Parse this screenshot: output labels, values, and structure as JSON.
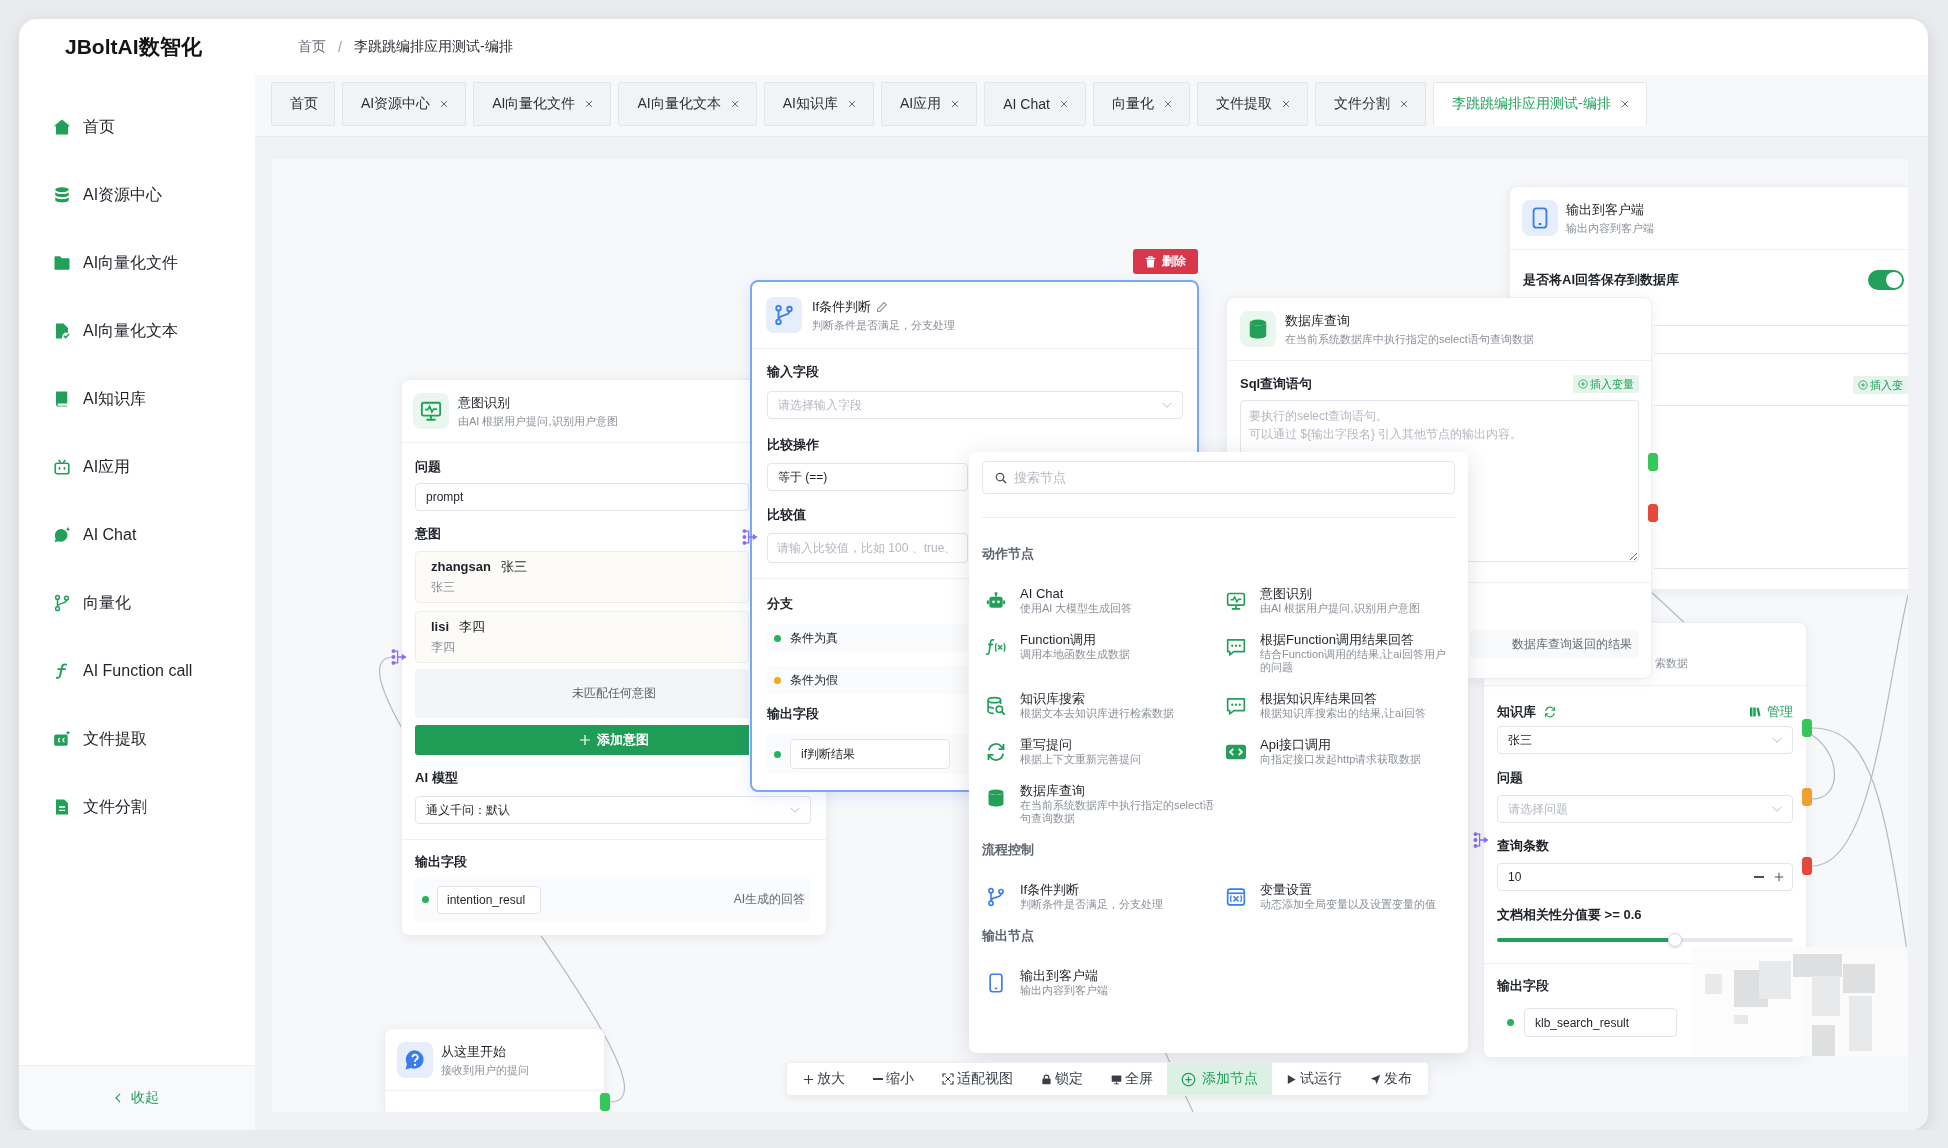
{
  "header": {
    "logo": "JBoltAI数智化",
    "breadcrumb": {
      "items": [
        "首页",
        "李跳跳编排应用测试-编排"
      ],
      "separator": "/"
    }
  },
  "sidebar": {
    "items": [
      {
        "label": "首页",
        "selected": false
      },
      {
        "label": "AI资源中心",
        "selected": false
      },
      {
        "label": "AI向量化文件",
        "selected": false
      },
      {
        "label": "AI向量化文本",
        "selected": false
      },
      {
        "label": "AI知识库",
        "selected": false
      },
      {
        "label": "AI应用",
        "selected": false
      },
      {
        "label": "AI Chat",
        "selected": false
      },
      {
        "label": "向量化",
        "selected": false
      },
      {
        "label": "AI Function call",
        "selected": false
      },
      {
        "label": "文件提取",
        "selected": false
      },
      {
        "label": "文件分割",
        "selected": false
      }
    ],
    "collapse": "收起"
  },
  "tabs": [
    {
      "label": "首页",
      "closable": false,
      "selected": false
    },
    {
      "label": "AI资源中心",
      "closable": true,
      "selected": false
    },
    {
      "label": "AI向量化文件",
      "closable": true,
      "selected": false
    },
    {
      "label": "AI向量化文本",
      "closable": true,
      "selected": false
    },
    {
      "label": "AI知识库",
      "closable": true,
      "selected": false
    },
    {
      "label": "AI应用",
      "closable": true,
      "selected": false
    },
    {
      "label": "AI Chat",
      "closable": true,
      "selected": false
    },
    {
      "label": "向量化",
      "closable": true,
      "selected": false
    },
    {
      "label": "文件提取",
      "closable": true,
      "selected": false
    },
    {
      "label": "文件分割",
      "closable": true,
      "selected": false
    },
    {
      "label": "李跳跳编排应用测试-编排",
      "closable": true,
      "selected": true
    }
  ],
  "canvas": {
    "output_node": {
      "title": "输出到客户端",
      "subtitle": "输出内容到客户端",
      "save_to_db": {
        "label": "是否将AI回答保存到数据库",
        "on": true
      },
      "insert_button": "插入变"
    },
    "if_node": {
      "selected": true,
      "delete_button": "删除",
      "title": "If条件判断",
      "subtitle": "判断条件是否满足，分支处理",
      "input": {
        "label": "输入字段",
        "placeholder": "请选择输入字段"
      },
      "operator": {
        "label": "比较操作",
        "value": "等于 (==)"
      },
      "compare": {
        "label": "比较值",
        "placeholder": "请输入比较值，比如 100 、true、"
      },
      "branches": {
        "label": "分支",
        "items": [
          {
            "label": "条件为真",
            "color": "#27b35b"
          },
          {
            "label": "条件为假",
            "color": "#f5a524"
          }
        ]
      },
      "output": {
        "label": "输出字段",
        "field": "if判断结果"
      }
    },
    "db_node": {
      "title": "数据库查询",
      "subtitle": "在当前系统数据库中执行指定的select语句查询数据",
      "sql": {
        "label": "Sql查询语句",
        "insert_button": "插入变量",
        "placeholder": [
          "要执行的select查询语句。",
          "可以通过 ${输出字段名} 引入其他节点的输出内容。"
        ]
      },
      "output": {
        "description": "数据库查询返回的结果"
      },
      "handles": [
        {
          "color": "#35c759"
        },
        {
          "color": "#e5493a"
        }
      ]
    },
    "intent_node": {
      "title": "意图识别",
      "subtitle": "由AI 根据用户提问,识别用户意图",
      "question": {
        "label": "问题",
        "value": "prompt"
      },
      "intents": {
        "label": "意图",
        "items": [
          {
            "name": "zhangsan",
            "label": "张三",
            "description": "张三"
          },
          {
            "name": "lisi",
            "label": "李四",
            "description": "李四"
          }
        ],
        "fallback": "未匹配任何意图",
        "add_button": "添加意图"
      },
      "model": {
        "label": "AI 模型",
        "value": "通义千问：默认"
      },
      "output": {
        "label": "输出字段",
        "field": "intention_resul",
        "description": "AI生成的回答"
      }
    },
    "knowledge_node": {
      "subtitle": "索数据",
      "knowledge_base": {
        "label": "知识库",
        "manage_link": "管理",
        "value": "张三"
      },
      "question": {
        "label": "问题",
        "placeholder": "请选择问题"
      },
      "count": {
        "label": "查询条数",
        "value": "10"
      },
      "score": {
        "label": "文档相关性分值要 >= 0.6",
        "level": 0.6
      },
      "output": {
        "label": "输出字段",
        "field": "klb_search_result"
      },
      "handles": [
        {
          "color": "#35c759"
        },
        {
          "color": "#f0a030"
        },
        {
          "color": "#e5493a"
        }
      ]
    },
    "start_node": {
      "title": "从这里开始",
      "subtitle": "接收到用户的提问",
      "handles": [
        {
          "color": "#35c759"
        }
      ]
    },
    "add_node_menu": {
      "search": {
        "placeholder": "搜索节点"
      },
      "sections": [
        {
          "title": "动作节点",
          "items": [
            {
              "title": "AI Chat",
              "description": "使用AI 大模型生成回答"
            },
            {
              "title": "意图识别",
              "description": "由AI 根据用户提问,识别用户意图"
            },
            {
              "title": "Function调用",
              "description": "调用本地函数生成数据"
            },
            {
              "title": "根据Function调用结果回答",
              "description": "结合Function调用的结果,让ai回答用户的问题"
            },
            {
              "title": "知识库搜索",
              "description": "根据文本去知识库进行检索数据"
            },
            {
              "title": "根据知识库结果回答",
              "description": "根据知识库搜索出的结果,让ai回答"
            },
            {
              "title": "重写提问",
              "description": "根据上下文重新完善提问"
            },
            {
              "title": "Api接口调用",
              "description": "向指定接口发起http请求获取数据"
            },
            {
              "title": "数据库查询",
              "description": "在当前系统数据库中执行指定的select语句查询数据"
            }
          ]
        },
        {
          "title": "流程控制",
          "items": [
            {
              "title": "If条件判断",
              "description": "判断条件是否满足，分支处理"
            },
            {
              "title": "变量设置",
              "description": "动态添加全局变量以及设置变量的值"
            }
          ]
        },
        {
          "title": "输出节点",
          "items": [
            {
              "title": "输出到客户端",
              "description": "输出内容到客户端"
            }
          ]
        }
      ]
    },
    "toolbar": [
      {
        "label": "放大",
        "selected": false
      },
      {
        "label": "缩小",
        "selected": false
      },
      {
        "label": "适配视图",
        "selected": false
      },
      {
        "label": "锁定",
        "selected": false
      },
      {
        "label": "全屏",
        "selected": false
      },
      {
        "label": "添加节点",
        "selected": true
      },
      {
        "label": "试运行",
        "selected": false
      },
      {
        "label": "发布",
        "selected": false
      }
    ]
  }
}
